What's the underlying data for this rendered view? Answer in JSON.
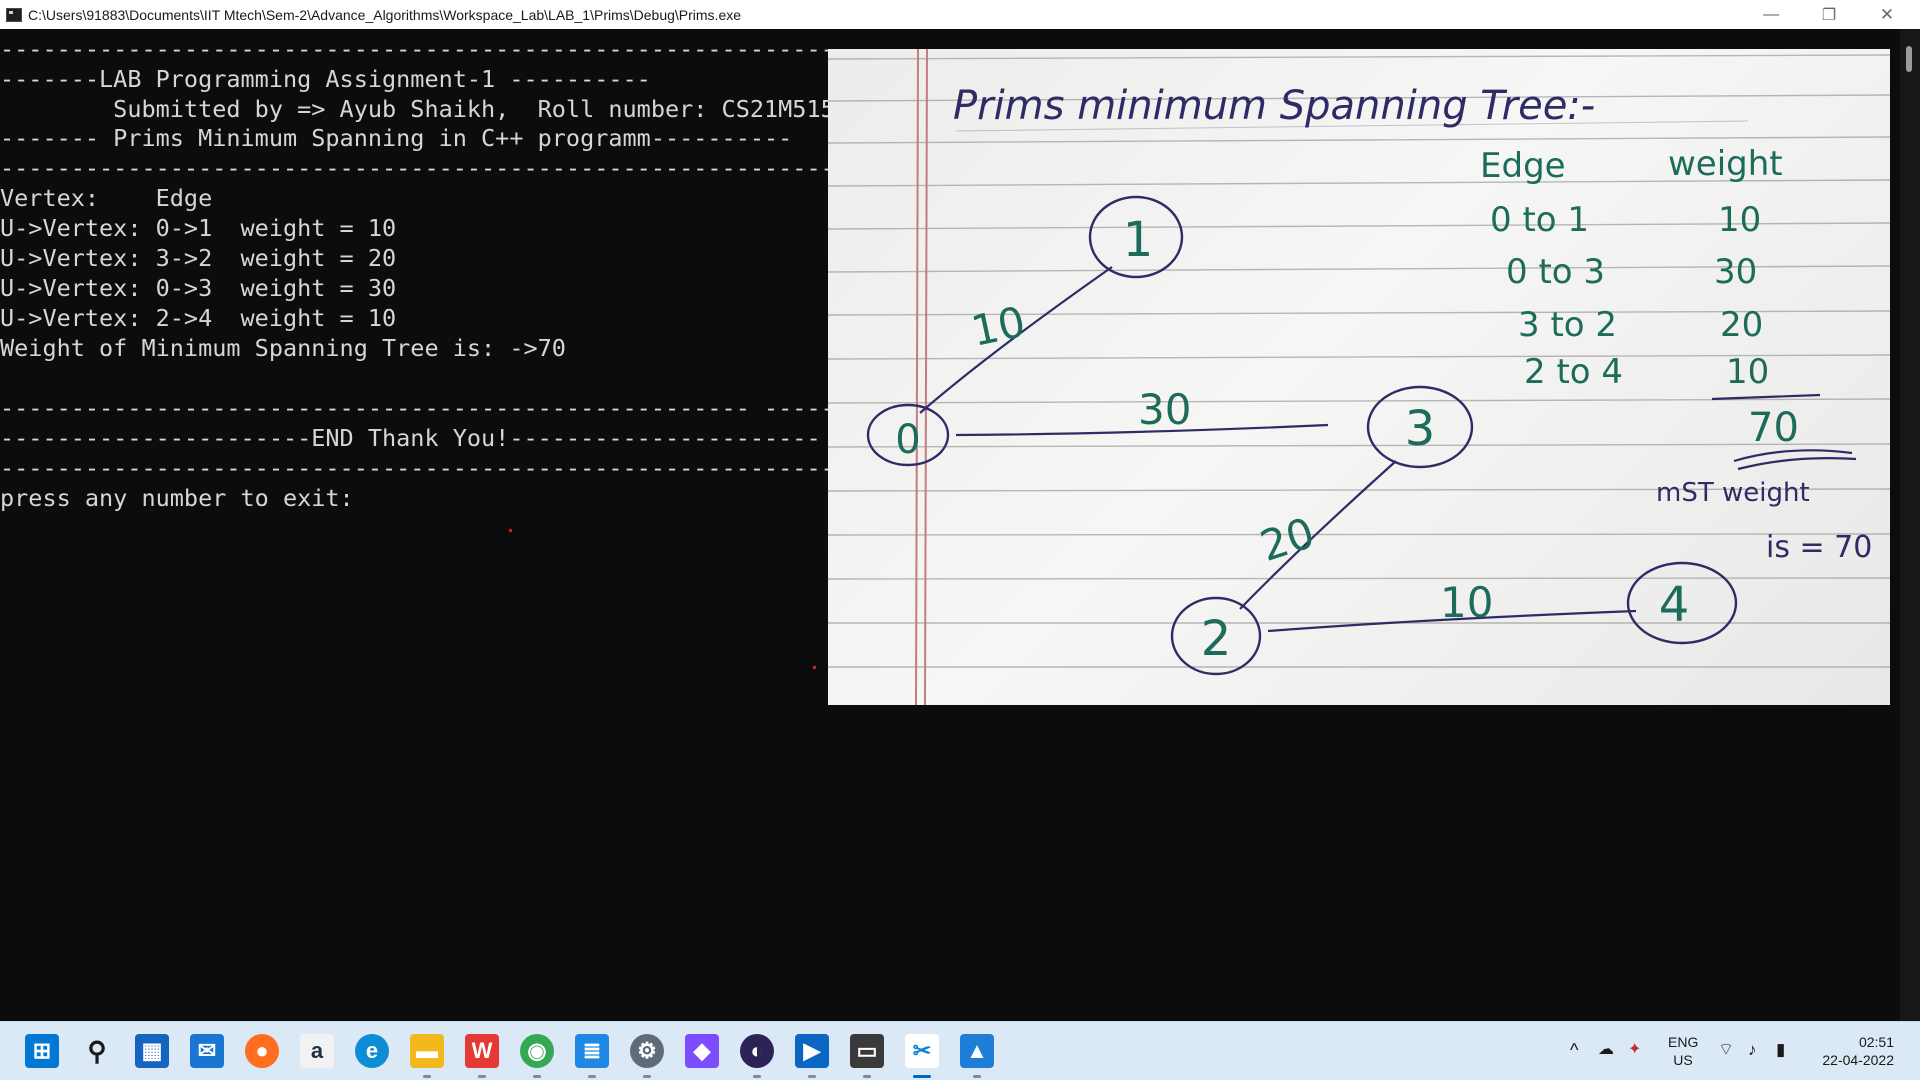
{
  "window": {
    "title": "C:\\Users\\91883\\Documents\\IIT Mtech\\Sem-2\\Advance_Algorithms\\Workspace_Lab\\LAB_1\\Prims\\Debug\\Prims.exe",
    "minimize_glyph": "—",
    "maximize_glyph": "❐",
    "close_glyph": "✕"
  },
  "console": {
    "lines": [
      "------------------------------------------------------------------",
      "-------LAB Programming Assignment-1 ----------",
      "        Submitted by => Ayub Shaikh,  Roll number: CS21M515",
      "------- Prims Minimum Spanning in C++ programm----------",
      "------------------------------------------------------------",
      "Vertex:    Edge",
      "U->Vertex: 0->1  weight = 10",
      "U->Vertex: 3->2  weight = 20",
      "U->Vertex: 0->3  weight = 30",
      "U->Vertex: 2->4  weight = 10",
      "Weight of Minimum Spanning Tree is: ->70",
      "",
      "----------------------------------------------------- ------",
      "----------------------END Thank You!----------------------",
      "------------------------------------------------------------",
      "press any number to exit:"
    ]
  },
  "notebook": {
    "title": "Prims  minimum  Spanning  Tree:-",
    "table_headers": [
      "Edge",
      "weight"
    ],
    "table_rows": [
      {
        "edge": "0 to 1",
        "weight": "10"
      },
      {
        "edge": "0 to 3",
        "weight": "30"
      },
      {
        "edge": "3 to 2",
        "weight": "20"
      },
      {
        "edge": "2 to 4",
        "weight": "10"
      }
    ],
    "total": "70",
    "mst_line1": "mST weight",
    "mst_line2": "is = 70",
    "nodes": [
      "0",
      "1",
      "2",
      "3",
      "4"
    ],
    "edge_labels": [
      "10",
      "30",
      "20",
      "10"
    ]
  },
  "taskbar": {
    "icons": [
      {
        "name": "start-icon",
        "glyph": "⊞",
        "color": "#0078d4"
      },
      {
        "name": "search-icon",
        "glyph": "⚲",
        "color": "#1a1a1a"
      },
      {
        "name": "store-icon",
        "glyph": "▦",
        "color": "#1565c0"
      },
      {
        "name": "mail-icon",
        "glyph": "✉",
        "color": "#1976d2"
      },
      {
        "name": "firefox-icon",
        "glyph": "●",
        "color": "#ff6d1f"
      },
      {
        "name": "amazon-icon",
        "glyph": "a",
        "color": "#232f3e"
      },
      {
        "name": "edge-icon",
        "glyph": "e",
        "color": "#0c8dd6"
      },
      {
        "name": "file-explorer-icon",
        "glyph": "▬",
        "color": "#f3b81c"
      },
      {
        "name": "wps-office-icon",
        "glyph": "W",
        "color": "#e53935"
      },
      {
        "name": "chrome-icon",
        "glyph": "◉",
        "color": "#34a853"
      },
      {
        "name": "notepad-icon",
        "glyph": "≣",
        "color": "#1e88e5"
      },
      {
        "name": "settings-icon",
        "glyph": "⚙",
        "color": "#5f6b78"
      },
      {
        "name": "devtools-icon",
        "glyph": "◆",
        "color": "#7c4dff"
      },
      {
        "name": "eclipse-icon",
        "glyph": "◐",
        "color": "#2c2255"
      },
      {
        "name": "media-player-icon",
        "glyph": "▶",
        "color": "#0a66c2"
      },
      {
        "name": "terminal-icon",
        "glyph": "▭",
        "color": "#3a3a3a"
      },
      {
        "name": "snipping-tool-icon",
        "glyph": "✂",
        "color": "#0a84d8"
      },
      {
        "name": "photos-icon",
        "glyph": "▲",
        "color": "#1e7ed6"
      }
    ],
    "tray": {
      "chevron_glyph": "^",
      "language_line1": "ENG",
      "language_line2": "US",
      "time": "02:51",
      "date": "22-04-2022"
    }
  },
  "colors": {
    "console_bg": "#0c0c0c",
    "console_text": "#d6d6d6",
    "ink_blue": "#2e2b66",
    "ink_teal": "#1d6b5b",
    "taskbar_bg": "#dbe9f6"
  }
}
